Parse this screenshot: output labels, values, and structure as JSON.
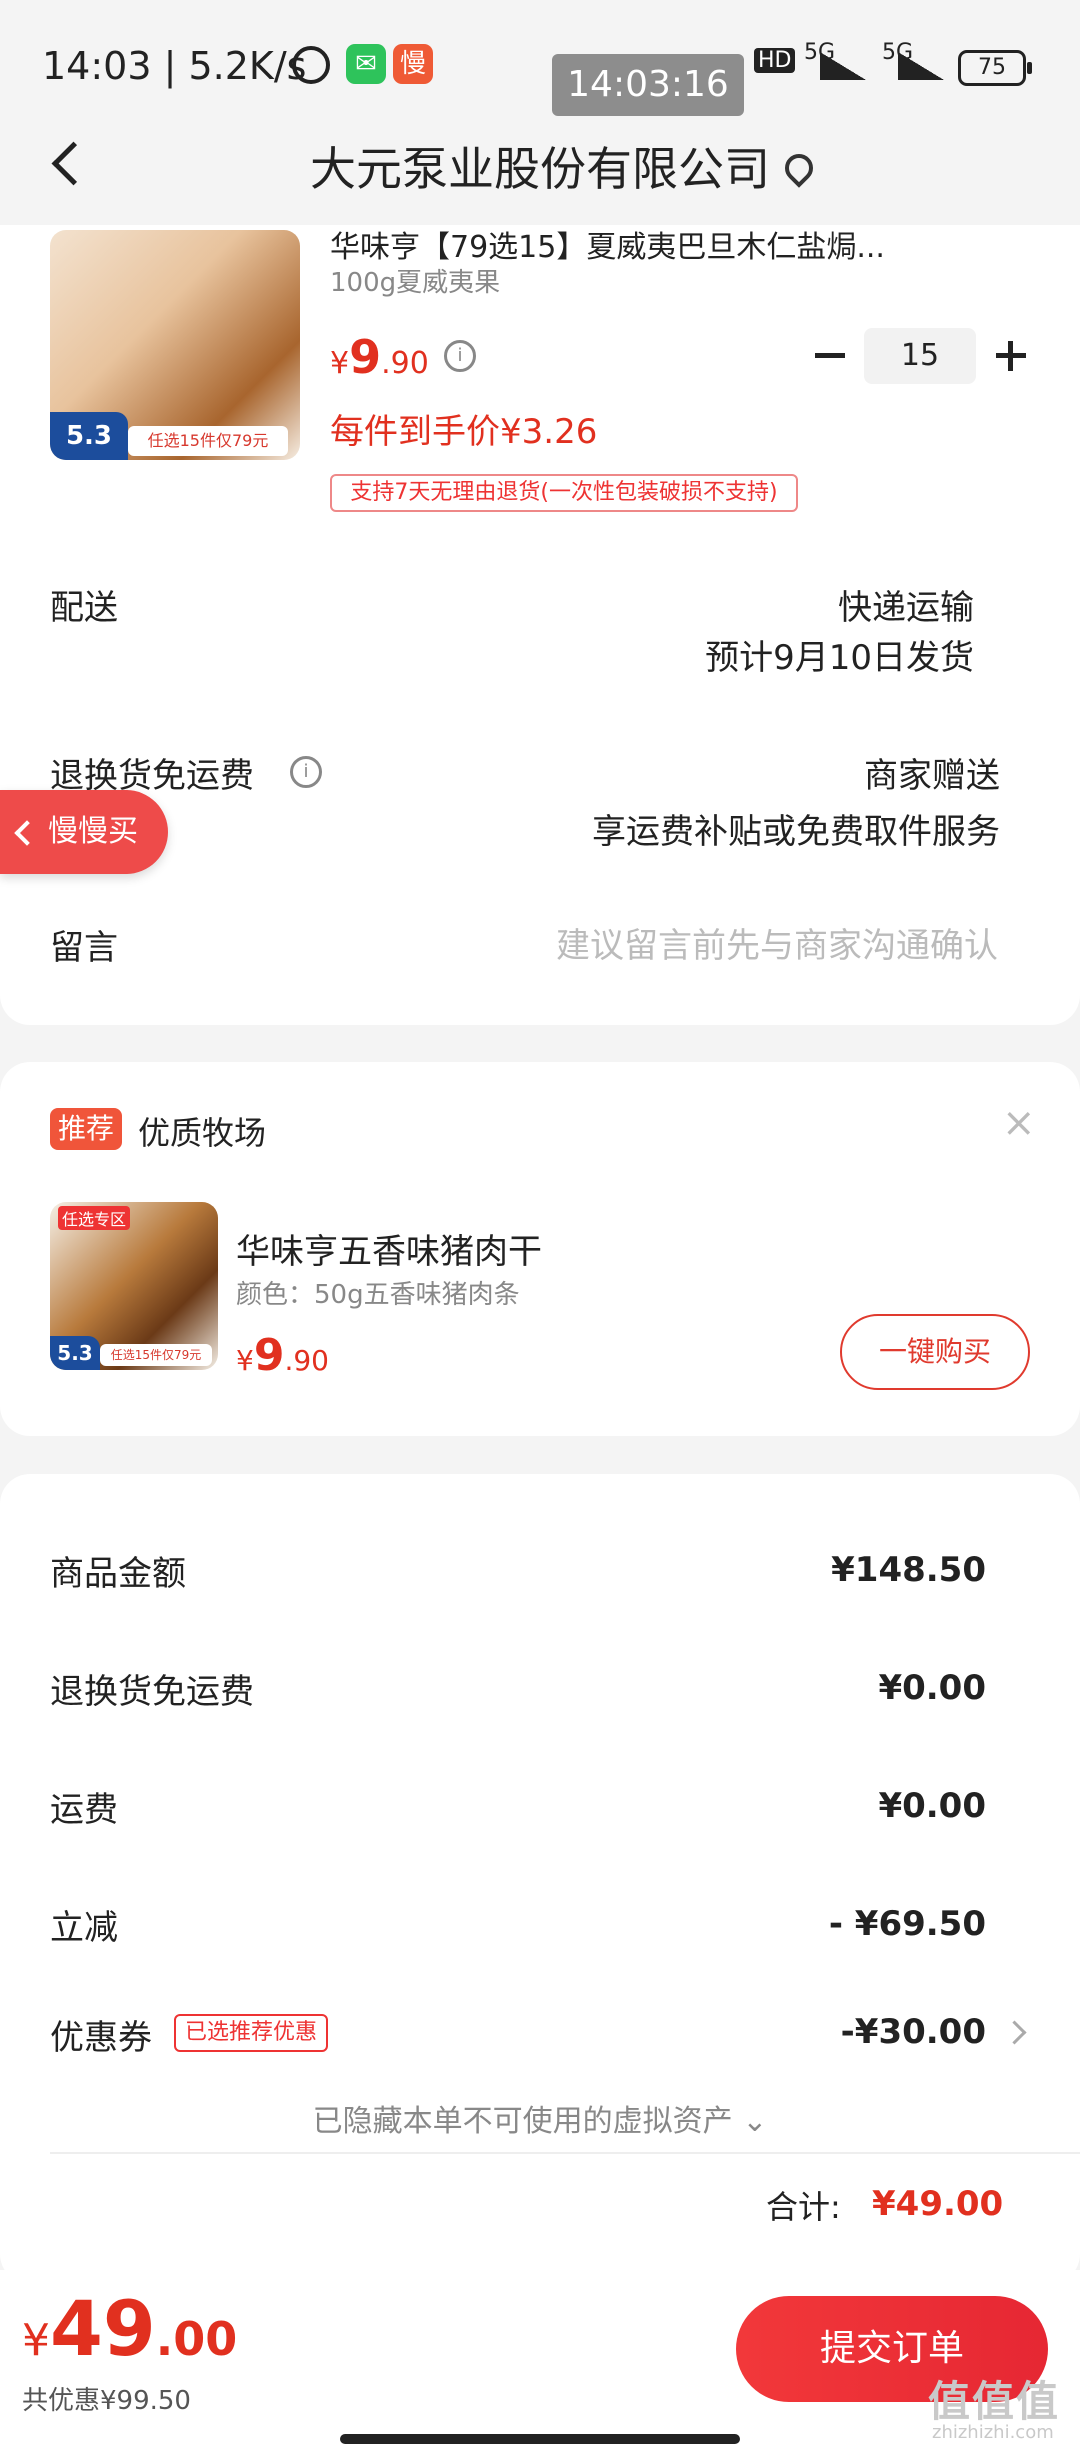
{
  "status_bar": {
    "time": "14:03",
    "speed": "| 5.2K/s",
    "slow_badge": "慢",
    "overlay_time": "14:03:16",
    "hd": "HD",
    "net1": "5G",
    "net2": "5G",
    "battery": "75"
  },
  "header": {
    "title": "大元泵业股份有限公司"
  },
  "product": {
    "name": "华味亨【79选15】夏威夷巴旦木仁盐焗...",
    "spec": "100g夏威夷果",
    "price_symbol": "¥",
    "price_int": "9",
    "price_dec": ".90",
    "quantity": "15",
    "per_item_price": "每件到手价¥3.26",
    "return_tag": "支持7天无理由退货(一次性包装破损不支持)",
    "img_badge": "5.3",
    "img_strip": "任选15件仅79元"
  },
  "delivery": {
    "label": "配送",
    "method": "快递运输",
    "estimate": "预计9月10日发货"
  },
  "return_shipping": {
    "label": "退换货免运费",
    "value": "商家赠送",
    "desc": "享运费补贴或免费取件服务"
  },
  "float_tab": {
    "label": "慢慢买"
  },
  "message": {
    "label": "留言",
    "placeholder": "建议留言前先与商家沟通确认"
  },
  "recommend": {
    "tag": "推荐",
    "shop": "优质牧场",
    "item_name": "华味亨五香味猪肉干",
    "item_spec": "颜色：50g五香味猪肉条",
    "price_symbol": "¥",
    "price_int": "9",
    "price_dec": ".90",
    "buy_button": "一键购买",
    "img_corner": "任选专区",
    "img_badge": "5.3",
    "img_strip": "任选15件仅79元"
  },
  "summary": {
    "rows": [
      {
        "label": "商品金额",
        "value": "¥148.50"
      },
      {
        "label": "退换货免运费",
        "value": "¥0.00"
      },
      {
        "label": "运费",
        "value": "¥0.00"
      },
      {
        "label": "立减",
        "value": "- ¥69.50"
      },
      {
        "label": "优惠券",
        "value": "-¥30.00"
      }
    ],
    "coupon_tag": "已选推荐优惠",
    "hidden_note": "已隐藏本单不可使用的虚拟资产",
    "total_label": "合计:",
    "total_value": "¥49.00"
  },
  "bottom_bar": {
    "price_symbol": "¥",
    "price_int": "49",
    "price_dec": ".00",
    "saved": "共优惠¥99.50",
    "submit": "提交订单"
  },
  "watermark": {
    "main": "值值值",
    "sub": "zhizhizhi.com"
  },
  "colors": {
    "accent": "#e1301f",
    "background": "#f4f4f4",
    "card": "#ffffff"
  }
}
